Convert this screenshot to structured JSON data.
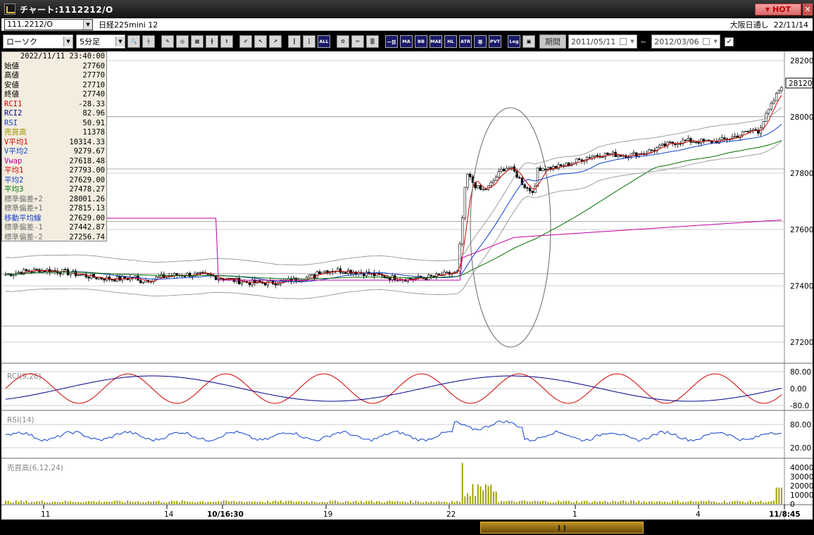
{
  "window": {
    "title": "チャート:1112212/O"
  },
  "hot_badge": "HOT",
  "symbol": {
    "code": "111.2212/O",
    "name": "日経225mini 12",
    "market": "大阪日通し",
    "date": "22/11/14"
  },
  "toolbar": {
    "chart_type": "ローソク",
    "interval": "5分足",
    "buttons": [
      "zoom",
      "crosshair",
      "draw",
      "target",
      "grid",
      "candle",
      "warning",
      "pen",
      "arrow",
      "cursor",
      "tick1",
      "tick2",
      "all",
      "gear",
      "brush",
      "rainbow",
      "ichimoku",
      "ma",
      "bb",
      "mae",
      "hl",
      "atr",
      "band",
      "pvt",
      "log",
      "save"
    ],
    "text_buttons": {
      "all": "ALL",
      "ichimoku": "一目",
      "ma": "MA",
      "bb": "BB",
      "mae": "MAE",
      "hl": "HL",
      "atr": "ATR",
      "band": "帯",
      "pvt": "PVT",
      "log": "Log"
    },
    "period_label": "期間",
    "date_from": "2011/05/11",
    "date_to": "2012/03/06",
    "tilde": "~"
  },
  "data_panel": {
    "datetime": "2022/11/11  23:40:00",
    "rows": [
      {
        "label": "始値",
        "value": "27760",
        "color": "#000000"
      },
      {
        "label": "高値",
        "value": "27770",
        "color": "#000000"
      },
      {
        "label": "安値",
        "value": "27710",
        "color": "#000000"
      },
      {
        "label": "終値",
        "value": "27740",
        "color": "#000000"
      },
      {
        "label": "RCI1",
        "value": "-28.33",
        "color": "#d00000"
      },
      {
        "label": "RCI2",
        "value": "82.96",
        "color": "#000090"
      },
      {
        "label": "RSI",
        "value": "50.91",
        "color": "#1040d0"
      },
      {
        "label": "売買高",
        "value": "11378",
        "color": "#a09000"
      },
      {
        "label": "V平均1",
        "value": "10314.33",
        "color": "#d00000"
      },
      {
        "label": "V平均2",
        "value": "9279.67",
        "color": "#1040d0"
      },
      {
        "label": "Vwap",
        "value": "27618.48",
        "color": "#c000a0"
      },
      {
        "label": "平均1",
        "value": "27793.00",
        "color": "#d00000"
      },
      {
        "label": "平均2",
        "value": "27629.00",
        "color": "#1040d0"
      },
      {
        "label": "平均3",
        "value": "27478.27",
        "color": "#007000"
      },
      {
        "label": "標準偏差+2",
        "value": "28001.26",
        "color": "#707070"
      },
      {
        "label": "標準偏差+1",
        "value": "27815.13",
        "color": "#707070"
      },
      {
        "label": "移動平均線",
        "value": "27629.00",
        "color": "#1040d0"
      },
      {
        "label": "標準偏差-1",
        "value": "27442.87",
        "color": "#707070"
      },
      {
        "label": "標準偏差-2",
        "value": "27256.74",
        "color": "#707070"
      }
    ]
  },
  "price_axis": [
    "28200",
    "28000",
    "27800",
    "27600",
    "27400",
    "27200"
  ],
  "last_price": "28120",
  "rci_panel": {
    "label": "RCI(9,26)",
    "ticks": [
      "80.00",
      "0.00",
      "-80.0"
    ]
  },
  "rsi_panel": {
    "label": "RSI(14)",
    "ticks": [
      "80.00",
      "20.00"
    ]
  },
  "volume_panel": {
    "label": "売買高(6,12,24)",
    "ticks": [
      "40000",
      "30000",
      "20000",
      "10000",
      "0"
    ]
  },
  "x_axis": [
    "11",
    "14",
    "10/16:30",
    "19",
    "22",
    "1",
    "4",
    "11/8:45"
  ],
  "colors": {
    "candle_up": "#ffffff",
    "candle_down": "#000000",
    "ma1": "#d00000",
    "ma2": "#1040d0",
    "ma3": "#007000",
    "vwap": "#c000a0",
    "volume": "#a0a000"
  }
}
